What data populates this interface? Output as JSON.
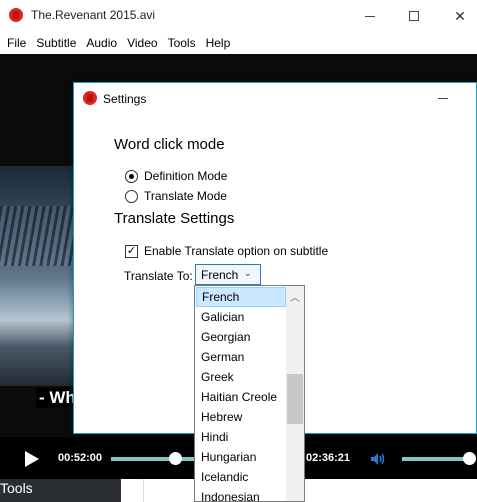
{
  "window": {
    "title": "The.Revenant 2015.avi"
  },
  "menu": {
    "items": [
      "File",
      "Subtitle",
      "Audio",
      "Video",
      "Tools",
      "Help"
    ]
  },
  "video": {
    "subtitle": "- Wh"
  },
  "controls": {
    "current_time": "00:52:00",
    "total_time": "02:36:21",
    "seek_progress": 0.33,
    "volume_level": 1.0,
    "accent_color": "#7fc8c5"
  },
  "bottom": {
    "tools_label": "Tools"
  },
  "settings": {
    "title": "Settings",
    "word_click_heading": "Word click mode",
    "mode_options": [
      {
        "label": "Definition Mode",
        "checked": true
      },
      {
        "label": "Translate Mode",
        "checked": false
      }
    ],
    "translate_heading": "Translate Settings",
    "enable_translate_label": "Enable Translate option on subtitle",
    "enable_translate_checked": true,
    "translate_to_label": "Translate To:",
    "selected_language": "French"
  },
  "dropdown": {
    "options": [
      "French",
      "Galician",
      "Georgian",
      "German",
      "Greek",
      "Haitian Creole",
      "Hebrew",
      "Hindi",
      "Hungarian",
      "Icelandic",
      "Indonesian"
    ],
    "selected_index": 0
  },
  "icons": {
    "app": "app-logo-icon",
    "play": "play-icon",
    "volume": "speaker-icon",
    "chevron": "chevron-down-icon",
    "scroll_up": "arrow-up-icon"
  }
}
